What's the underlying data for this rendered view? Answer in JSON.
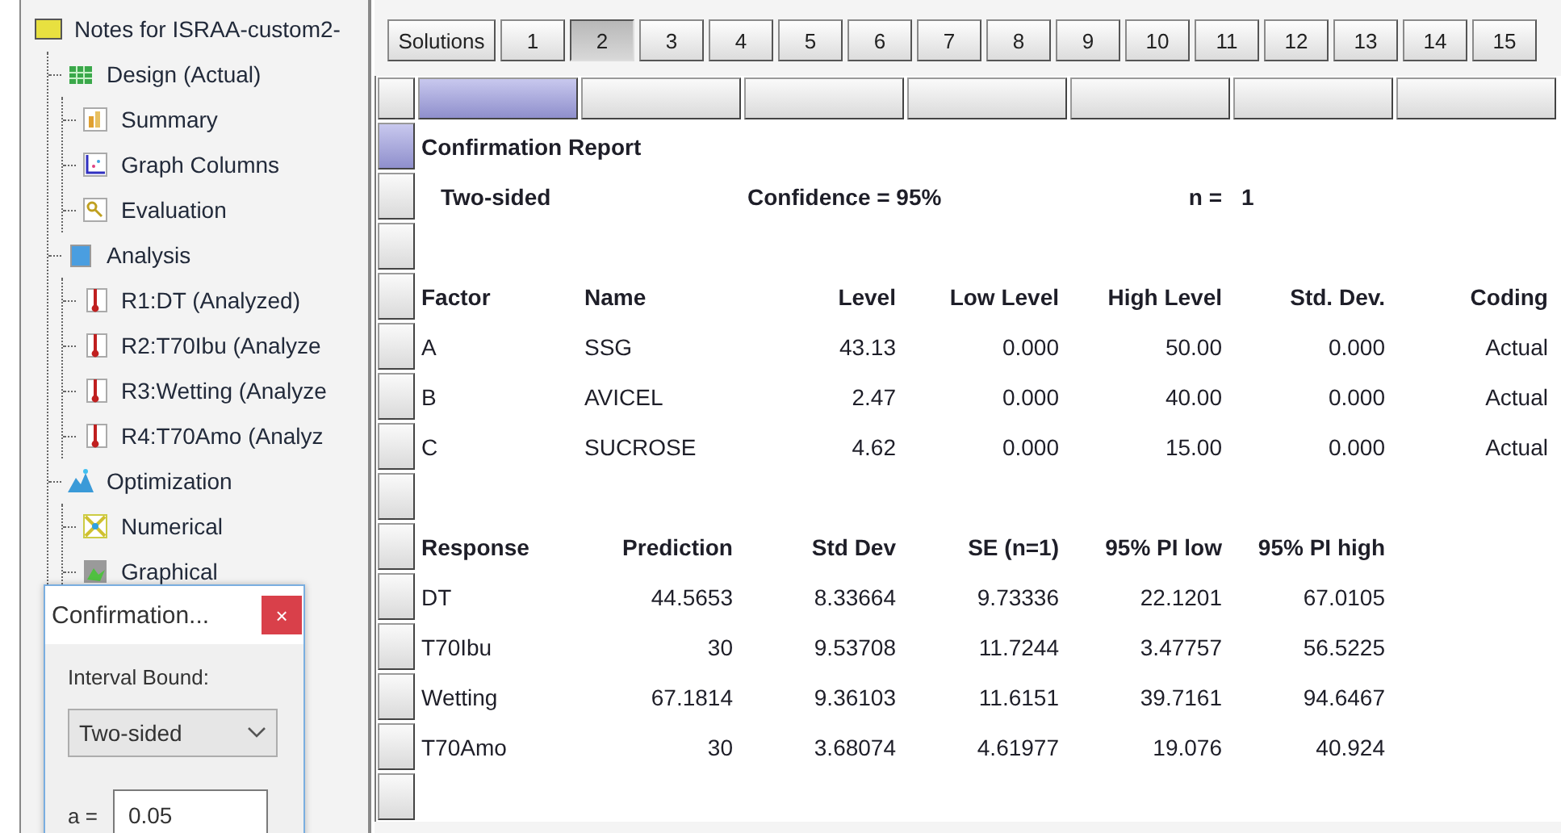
{
  "tree": [
    {
      "label": "Notes for ISRAA-custom2-",
      "kind": "notes",
      "children": [
        {
          "label": "Design (Actual)",
          "kind": "design",
          "children": [
            {
              "label": "Summary",
              "kind": "summary"
            },
            {
              "label": "Graph Columns",
              "kind": "graph"
            },
            {
              "label": "Evaluation",
              "kind": "evaluation"
            }
          ]
        },
        {
          "label": "Analysis",
          "kind": "analysis",
          "children": [
            {
              "label": "R1:DT (Analyzed)",
              "kind": "response"
            },
            {
              "label": "R2:T70Ibu (Analyze",
              "kind": "response"
            },
            {
              "label": "R3:Wetting (Analyze",
              "kind": "response"
            },
            {
              "label": "R4:T70Amo (Analyz",
              "kind": "response"
            }
          ]
        },
        {
          "label": "Optimization",
          "kind": "optimization",
          "children": [
            {
              "label": "Numerical",
              "kind": "numerical"
            },
            {
              "label": "Graphical",
              "kind": "graphical"
            }
          ]
        }
      ]
    }
  ],
  "dialog": {
    "title": "Confirmation...",
    "close": "×",
    "interval_label": "Interval Bound:",
    "interval_value": "Two-sided",
    "alpha_label": "a =",
    "alpha_value": "0.05"
  },
  "solutions_label": "Solutions",
  "tabs": [
    {
      "label": "1",
      "selected": false
    },
    {
      "label": "2",
      "selected": true
    },
    {
      "label": "3",
      "selected": false
    },
    {
      "label": "4",
      "selected": false
    },
    {
      "label": "5",
      "selected": false
    },
    {
      "label": "6",
      "selected": false
    },
    {
      "label": "7",
      "selected": false
    },
    {
      "label": "8",
      "selected": false
    },
    {
      "label": "9",
      "selected": false
    },
    {
      "label": "10",
      "selected": false
    },
    {
      "label": "11",
      "selected": false
    },
    {
      "label": "12",
      "selected": false
    },
    {
      "label": "13",
      "selected": false
    },
    {
      "label": "14",
      "selected": false
    },
    {
      "label": "15",
      "selected": false
    }
  ],
  "grid": {
    "column_headers": [
      {
        "selected": true
      },
      {
        "selected": false
      },
      {
        "selected": false
      },
      {
        "selected": false
      },
      {
        "selected": false
      },
      {
        "selected": false
      },
      {
        "selected": false
      }
    ],
    "rows": [
      {
        "kind": "title",
        "selected": true,
        "text": "Confirmation Report"
      },
      {
        "kind": "summary",
        "selected": false,
        "sided": "Two-sided",
        "confidence": "Confidence = 95%",
        "n_label": "n =",
        "n_value": "1"
      },
      {
        "kind": "blank",
        "selected": false
      },
      {
        "kind": "factor_header",
        "selected": false,
        "cells": [
          "Factor",
          "Name",
          "Level",
          "Low Level",
          "High Level",
          "Std. Dev.",
          "Coding"
        ]
      },
      {
        "kind": "factor_row",
        "selected": false,
        "cells": [
          "A",
          "SSG",
          "43.13",
          "0.000",
          "50.00",
          "0.000",
          "Actual"
        ]
      },
      {
        "kind": "factor_row",
        "selected": false,
        "cells": [
          "B",
          "AVICEL",
          "2.47",
          "0.000",
          "40.00",
          "0.000",
          "Actual"
        ]
      },
      {
        "kind": "factor_row",
        "selected": false,
        "cells": [
          "C",
          "SUCROSE",
          "4.62",
          "0.000",
          "15.00",
          "0.000",
          "Actual"
        ]
      },
      {
        "kind": "blank",
        "selected": false
      },
      {
        "kind": "response_header",
        "selected": false,
        "cells": [
          "Response",
          "Prediction",
          "Std Dev",
          "SE (n=1)",
          "95% PI low",
          "95% PI high"
        ]
      },
      {
        "kind": "response_row",
        "selected": false,
        "cells": [
          "DT",
          "44.5653",
          "8.33664",
          "9.73336",
          "22.1201",
          "67.0105"
        ]
      },
      {
        "kind": "response_row",
        "selected": false,
        "cells": [
          "T70Ibu",
          "30",
          "9.53708",
          "11.7244",
          "3.47757",
          "56.5225"
        ]
      },
      {
        "kind": "response_row",
        "selected": false,
        "cells": [
          "Wetting",
          "67.1814",
          "9.36103",
          "11.6151",
          "39.7161",
          "94.6467"
        ]
      },
      {
        "kind": "response_row",
        "selected": false,
        "cells": [
          "T70Amo",
          "30",
          "3.68074",
          "4.61977",
          "19.076",
          "40.924"
        ]
      },
      {
        "kind": "blank",
        "selected": false
      }
    ]
  }
}
